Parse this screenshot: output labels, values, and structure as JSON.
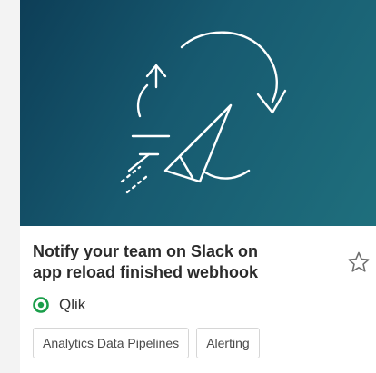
{
  "card": {
    "title_line1": "Notify your team on Slack on",
    "title_line2": "app reload finished webhook",
    "publisher": {
      "name": "Qlik",
      "icon": "qlik-logo-icon",
      "icon_color": "#1a9e4a"
    },
    "favorite_icon": "star-outline-icon",
    "tags": [
      "Analytics Data Pipelines",
      "Alerting"
    ],
    "hero": {
      "icon": "paper-plane-reload-icon",
      "gradient_from": "#0d3e57",
      "gradient_to": "#1f6f7d"
    }
  }
}
